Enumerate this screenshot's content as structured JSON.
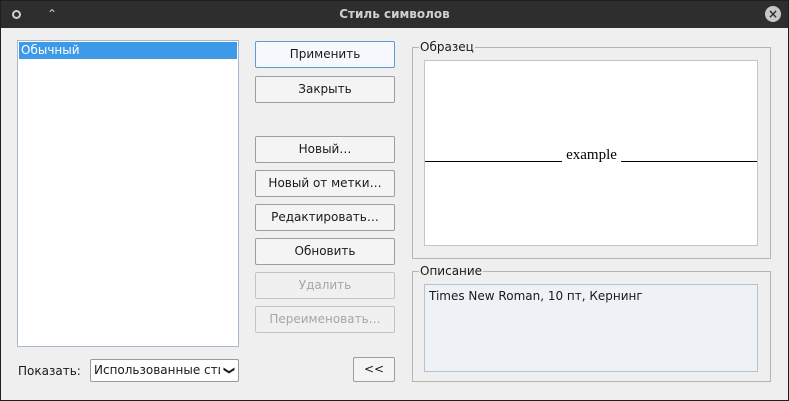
{
  "window": {
    "title": "Стиль символов"
  },
  "titlebar": {
    "menu_icon": "circle-icon",
    "up_icon": "chevron-up-icon",
    "close_icon": "close-icon",
    "up_glyph": "⌃",
    "close_glyph": "×"
  },
  "styles_list": {
    "items": [
      {
        "label": "Обычный",
        "selected": true
      }
    ]
  },
  "show": {
    "label": "Показать:",
    "selected": "Использованные стили",
    "chevron": "❯"
  },
  "buttons": {
    "apply": "Применить",
    "close": "Закрыть",
    "new": "Новый…",
    "new_from_marker": "Новый от метки…",
    "edit": "Редактировать…",
    "update": "Обновить",
    "delete": "Удалить",
    "rename": "Переименовать…",
    "collapse": "<<"
  },
  "preview": {
    "title": "Образец",
    "sample_text": "example"
  },
  "description": {
    "title": "Описание",
    "text": "Times New Roman, 10 пт, Кернинг"
  },
  "colors": {
    "selection": "#3d9ae8",
    "titlebar": "#2e2e2e",
    "background": "#efefef"
  }
}
